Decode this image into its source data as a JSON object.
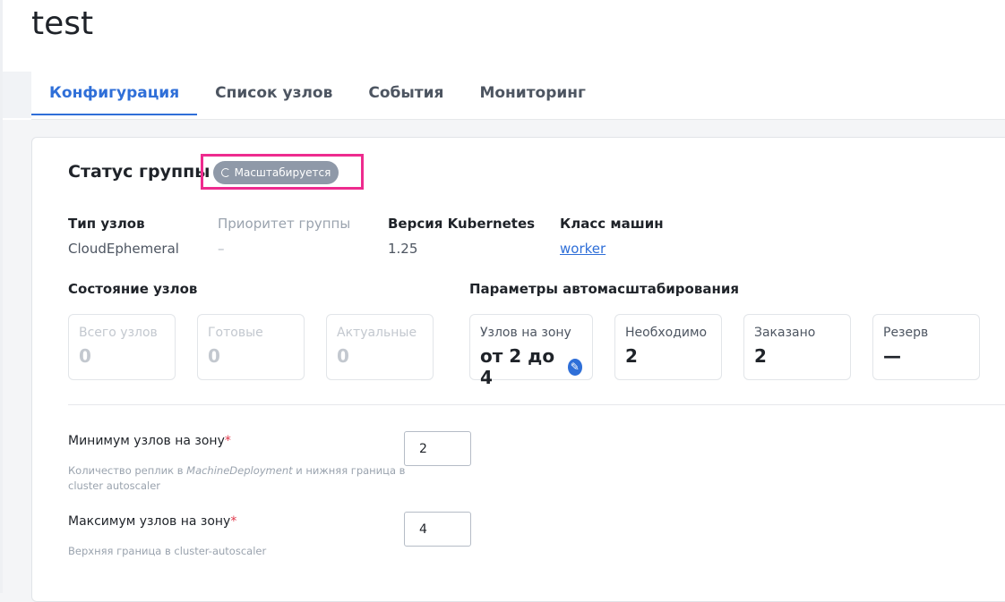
{
  "page": {
    "title": "test"
  },
  "tabs": [
    {
      "label": "Конфигурация",
      "active": true
    },
    {
      "label": "Список узлов",
      "active": false
    },
    {
      "label": "События",
      "active": false
    },
    {
      "label": "Мониторинг",
      "active": false
    }
  ],
  "status": {
    "title": "Статус группы",
    "badge": "Масштабируется",
    "badge_icon": "spinner-icon",
    "highlight_color": "#ee2b8e"
  },
  "info": {
    "node_type_label": "Тип узлов",
    "node_type_value": "CloudEphemeral",
    "priority_label": "Приоритет группы",
    "priority_value": "–",
    "k8s_label": "Версия Kubernetes",
    "k8s_value": "1.25",
    "class_label": "Класс машин",
    "class_value": "worker"
  },
  "node_state": {
    "title": "Состояние узлов",
    "total_label": "Всего узлов",
    "total_value": "0",
    "ready_label": "Готовые",
    "ready_value": "0",
    "actual_label": "Актуальные",
    "actual_value": "0"
  },
  "autoscale": {
    "title": "Параметры автомасштабирования",
    "per_zone_label": "Узлов на зону",
    "per_zone_value": "от 2 до 4",
    "required_label": "Необходимо",
    "required_value": "2",
    "ordered_label": "Заказано",
    "ordered_value": "2",
    "reserve_label": "Резерв",
    "reserve_value": "—"
  },
  "form": {
    "min_label": "Минимум узлов на зону",
    "min_hint_prefix": "Количество реплик в ",
    "min_hint_em": "MachineDeployment",
    "min_hint_suffix": " и нижняя граница в cluster autoscaler",
    "min_value": "2",
    "max_label": "Максимум узлов на зону",
    "max_hint": "Верхняя граница в cluster-autoscaler",
    "max_value": "4",
    "required_mark": "*"
  },
  "colors": {
    "accent": "#2f6fd8",
    "badge_bg": "#8f99a8",
    "required": "#e0384b"
  }
}
